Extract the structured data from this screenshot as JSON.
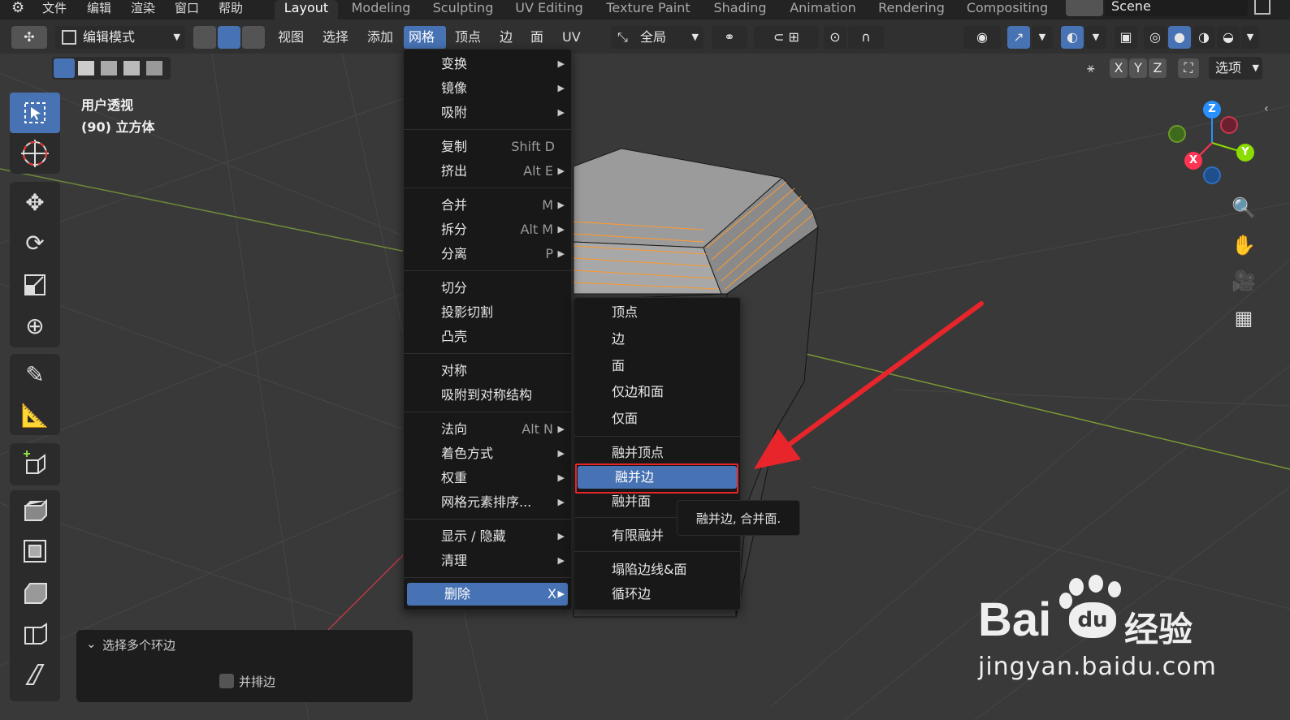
{
  "topmenu": [
    "文件",
    "编辑",
    "渲染",
    "窗口",
    "帮助"
  ],
  "workspaces": [
    "Layout",
    "Modeling",
    "Sculpting",
    "UV Editing",
    "Texture Paint",
    "Shading",
    "Animation",
    "Rendering",
    "Compositing"
  ],
  "scene_label": "Scene",
  "header": {
    "mode": "编辑模式",
    "menus": [
      "视图",
      "选择",
      "添加",
      "网格",
      "顶点",
      "边",
      "面",
      "UV"
    ],
    "transform_orientation": "全局",
    "options_label": "选项",
    "axis_x": "X",
    "axis_y": "Y",
    "axis_z": "Z"
  },
  "viewport": {
    "view_name": "用户透视",
    "object_info": "(90) 立方体"
  },
  "mesh_menu": {
    "items": [
      {
        "label": "变换",
        "shortcut": "",
        "submenu": true
      },
      {
        "label": "镜像",
        "shortcut": "",
        "submenu": true
      },
      {
        "label": "吸附",
        "shortcut": "",
        "submenu": true
      },
      {
        "label": "复制",
        "shortcut": "Shift D",
        "submenu": false
      },
      {
        "label": "挤出",
        "shortcut": "Alt E",
        "submenu": true
      },
      {
        "label": "合并",
        "shortcut": "M",
        "submenu": true
      },
      {
        "label": "拆分",
        "shortcut": "Alt M",
        "submenu": true
      },
      {
        "label": "分离",
        "shortcut": "P",
        "submenu": true
      },
      {
        "label": "切分",
        "shortcut": "",
        "submenu": false
      },
      {
        "label": "投影切割",
        "shortcut": "",
        "submenu": false
      },
      {
        "label": "凸壳",
        "shortcut": "",
        "submenu": false
      },
      {
        "label": "对称",
        "shortcut": "",
        "submenu": false
      },
      {
        "label": "吸附到对称结构",
        "shortcut": "",
        "submenu": false
      },
      {
        "label": "法向",
        "shortcut": "Alt N",
        "submenu": true
      },
      {
        "label": "着色方式",
        "shortcut": "",
        "submenu": true
      },
      {
        "label": "权重",
        "shortcut": "",
        "submenu": true
      },
      {
        "label": "网格元素排序...",
        "shortcut": "",
        "submenu": true
      },
      {
        "label": "显示 / 隐藏",
        "shortcut": "",
        "submenu": true
      },
      {
        "label": "清理",
        "shortcut": "",
        "submenu": true
      },
      {
        "label": "删除",
        "shortcut": "X",
        "submenu": true
      }
    ]
  },
  "delete_menu": {
    "items": [
      "顶点",
      "边",
      "面",
      "仅边和面",
      "仅面",
      "融并顶点",
      "融并边",
      "融并面",
      "有限融并",
      "塌陷边线&面",
      "循环边"
    ]
  },
  "tooltip": "融并边, 合并面.",
  "last_op_panel": {
    "title": "选择多个环边",
    "checkbox_label": "并排边"
  },
  "gizmo": {
    "x": "X",
    "y": "Y",
    "z": "Z"
  },
  "watermark": {
    "brand": "Bai",
    "brand2": "经验",
    "url": "jingyan.baidu.com"
  },
  "colors": {
    "accent": "#4772b3",
    "highlight_box": "#e8252b",
    "arrow": "#e8252b",
    "edge_select": "#ff9a2e",
    "axis_x": "#ff3352",
    "axis_y": "#8bdc00",
    "axis_z": "#2890ff"
  }
}
